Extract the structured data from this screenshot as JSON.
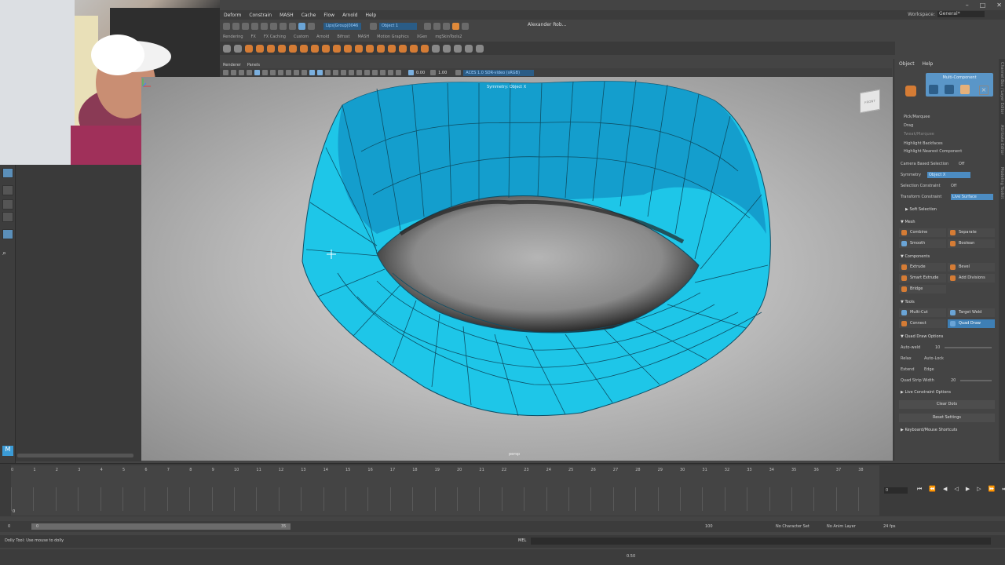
{
  "menubar": {
    "items": [
      "Deform",
      "Constrain",
      "MASH",
      "Cache",
      "Flow",
      "Arnold",
      "Help"
    ],
    "workspace_label": "Workspace:",
    "workspace_value": "General*"
  },
  "statusline": {
    "select_field": "Lips|Group|0046",
    "object_field": "Object 1",
    "user": "Alexander Rob..."
  },
  "shelf": {
    "tabs": [
      "Rendering",
      "FX",
      "FX Caching",
      "Custom",
      "Arnold",
      "Bifrost",
      "MASH",
      "Motion Graphics",
      "XGen",
      "mgSkinTools2"
    ]
  },
  "panel": {
    "menu": [
      "Renderer",
      "Panels"
    ],
    "field_a": "0.00",
    "field_b": "1.00",
    "colorspace": "ACES 1.0 SDR-video (sRGB)"
  },
  "viewport": {
    "symmetry_label": "Symmetry: Object X",
    "camera_label": "persp",
    "viewcube_label": "FRONT"
  },
  "right_panel": {
    "tabs": [
      "Object",
      "Help"
    ],
    "mode_title": "Multi-Component",
    "pick_marquee": "Pick/Marquee",
    "drag": "Drag",
    "tweak": "Tweak/Marquee",
    "highlight_backfaces": "Highlight Backfaces",
    "highlight_nearest": "Highlight Nearest Component",
    "camera_based": "Camera Based Selection",
    "camera_based_value": "Off",
    "symmetry": "Symmetry",
    "symmetry_value": "Object X",
    "selection_constraint": "Selection Constraint",
    "selection_constraint_value": "Off",
    "transform_constraint": "Transform Constraint",
    "transform_constraint_value": "Live Surface",
    "soft_selection": "Soft Selection",
    "mesh_section": "Mesh",
    "combine": "Combine",
    "separate": "Separate",
    "smooth": "Smooth",
    "boolean": "Boolean",
    "components_section": "Components",
    "extrude": "Extrude",
    "bevel": "Bevel",
    "smart_extrude": "Smart Extrude",
    "add_divisions": "Add Divisions",
    "bridge": "Bridge",
    "tools_section": "Tools",
    "multi_cut": "Multi-Cut",
    "target_weld": "Target Weld",
    "connect": "Connect",
    "quad_draw": "Quad Draw",
    "quad_draw_options": "Quad Draw Options",
    "auto_weld": "Auto-weld",
    "auto_weld_value": "10",
    "relax": "Relax",
    "relax_value": "Auto-Lock",
    "extend": "Extend",
    "extend_value": "Edge",
    "quad_strip_width": "Quad Strip Width",
    "quad_strip_value": "20",
    "live_constraint": "Live Constraint Options",
    "clear_dots": "Clear Dots",
    "reset_settings": "Reset Settings",
    "shortcuts": "Keyboard/Mouse Shortcuts"
  },
  "vertical_tabs": [
    "Channel Box / Layer Editor",
    "Attribute Editor",
    "Modeling Toolkit"
  ],
  "timeline": {
    "ticks": [
      "0",
      "1",
      "2",
      "3",
      "4",
      "5",
      "6",
      "7",
      "8",
      "9",
      "10",
      "11",
      "12",
      "13",
      "14",
      "15",
      "16",
      "17",
      "18",
      "19",
      "20",
      "21",
      "22",
      "23",
      "24",
      "25",
      "26",
      "27",
      "28",
      "29",
      "30",
      "31",
      "32",
      "33",
      "34",
      "35",
      "36",
      "37",
      "38"
    ],
    "current_frame": "0",
    "left_frame": "0"
  },
  "range": {
    "start": "0",
    "start2": "0",
    "end": "35",
    "end2": "100",
    "character_set": "No Character Set",
    "anim_layer": "No Anim Layer",
    "fps": "24 fps"
  },
  "commandline": {
    "mel_label": "MEL",
    "help_text": "Dolly Tool: Use mouse to dolly",
    "zoom_value": "0.50"
  }
}
